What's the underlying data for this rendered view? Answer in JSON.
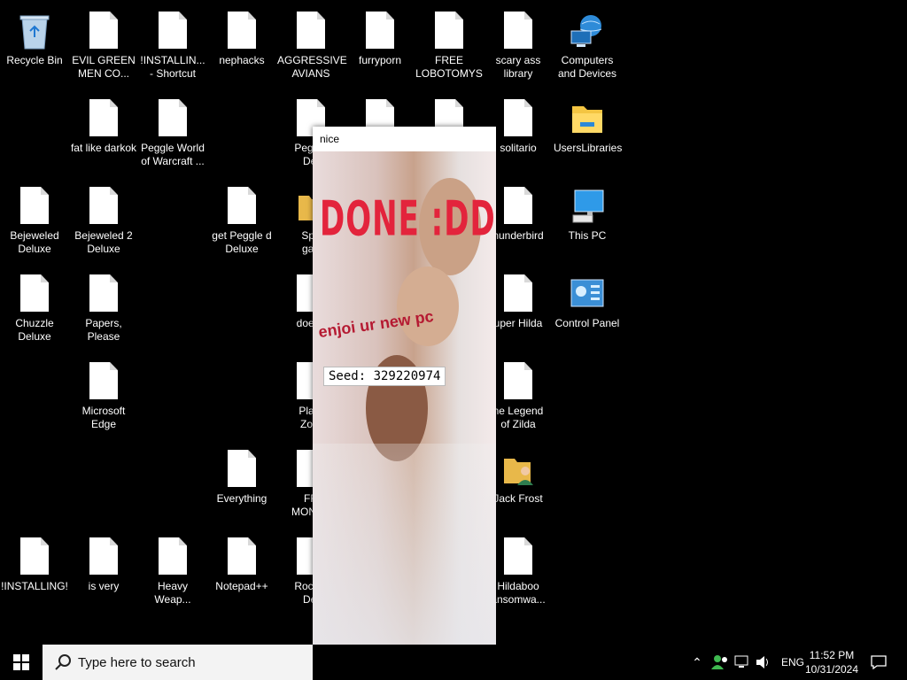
{
  "desktop": {
    "icons": [
      {
        "label": "Recycle Bin",
        "kind": "recycle-bin"
      },
      {
        "label": "EVIL GREEN\nMEN CO...",
        "kind": "file"
      },
      {
        "label": "!INSTALLIN...\n- Shortcut",
        "kind": "file"
      },
      {
        "label": "nephacks",
        "kind": "file"
      },
      {
        "label": "AGGRESSIVE\nAVIANS",
        "kind": "file"
      },
      {
        "label": "furryporn",
        "kind": "file"
      },
      {
        "label": "FREE\nLOBOTOMYS",
        "kind": "file"
      },
      {
        "label": "scary ass\nlibrary",
        "kind": "file"
      },
      {
        "label": "Computers\nand Devices",
        "kind": "globe"
      },
      {
        "label": "fat like darkok",
        "kind": "file"
      },
      {
        "label": "Peggle World\nof Warcraft ...",
        "kind": "file"
      },
      {
        "label": "Peggle\nDel",
        "kind": "file"
      },
      {
        "label": "solitario",
        "kind": "file"
      },
      {
        "label": "UsersLibraries",
        "kind": "folder"
      },
      {
        "label": "Bejeweled\nDeluxe",
        "kind": "file"
      },
      {
        "label": "Bejeweled 2\nDeluxe",
        "kind": "file"
      },
      {
        "label": "get Peggle d\nDeluxe",
        "kind": "file"
      },
      {
        "label": "Spo\ngan",
        "kind": "file"
      },
      {
        "label": "hunderbird",
        "kind": "file"
      },
      {
        "label": "This PC",
        "kind": "pc"
      },
      {
        "label": "Chuzzle\nDeluxe",
        "kind": "file"
      },
      {
        "label": "Papers, Please",
        "kind": "file"
      },
      {
        "label": "doesn",
        "kind": "file"
      },
      {
        "label": "uper Hilda",
        "kind": "file"
      },
      {
        "label": "Control Panel",
        "kind": "control-panel"
      },
      {
        "label": "Microsoft\nEdge",
        "kind": "file"
      },
      {
        "label": "Plant\nZom",
        "kind": "file"
      },
      {
        "label": "he Legend\nof Zilda",
        "kind": "file"
      },
      {
        "label": "Everything",
        "kind": "file"
      },
      {
        "label": "FR\nMONEY",
        "kind": "file"
      },
      {
        "label": "Jack Frost",
        "kind": "user"
      },
      {
        "label": "!INSTALLING!",
        "kind": "file"
      },
      {
        "label": "is very",
        "kind": "file"
      },
      {
        "label": "Heavy\nWeap...",
        "kind": "file"
      },
      {
        "label": "Notepad++",
        "kind": "file"
      },
      {
        "label": "Rocket\nDel",
        "kind": "file"
      },
      {
        "label": "Hildaboo\nansomwa...",
        "kind": "file"
      }
    ]
  },
  "popup": {
    "title": "nice",
    "done_text": "DONE :DDDD",
    "enjoy_text": "enjoi ur new pc",
    "seed_label": "Seed: 329220974"
  },
  "taskbar": {
    "start_icon": "windows-logo-icon",
    "search_placeholder": "Type here to search",
    "language": "ENG",
    "time": "11:52 PM",
    "date": "10/31/2024"
  },
  "colors": {
    "desktop_bg": "#000000",
    "taskbar_bg": "#000000",
    "search_bg": "#f3f3f3",
    "done_red": "#e0223a"
  }
}
